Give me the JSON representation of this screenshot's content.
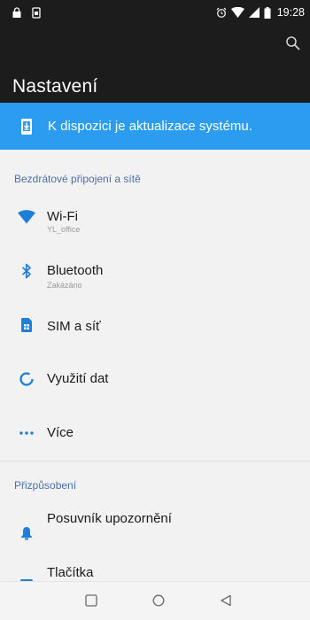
{
  "status_bar": {
    "time": "19:28",
    "left_icons": [
      "lock-icon",
      "sim-card-icon"
    ],
    "right_icons": [
      "alarm-icon",
      "wifi-icon",
      "signal-icon",
      "battery-icon"
    ]
  },
  "app_bar": {
    "title": "Nastavení",
    "action_icon": "search-icon"
  },
  "update_banner": {
    "text": "K dispozici je aktualizace systému.",
    "icon": "system-update-icon",
    "color": "#2b9cf0"
  },
  "sections": [
    {
      "header": "Bezdrátové připojení a sítě",
      "items": [
        {
          "label": "Wi-Fi",
          "subtitle": "YL_office",
          "icon": "wifi-icon"
        },
        {
          "label": "Bluetooth",
          "subtitle": "Zakázáno",
          "icon": "bluetooth-icon"
        },
        {
          "label": "SIM a síť",
          "subtitle": "",
          "icon": "sim-card-icon"
        },
        {
          "label": "Využití dat",
          "subtitle": "",
          "icon": "data-usage-icon"
        },
        {
          "label": "Více",
          "subtitle": "",
          "icon": "more-icon"
        }
      ]
    },
    {
      "header": "Přizpůsobení",
      "items": [
        {
          "label": "Posuvník upozornění",
          "subtitle": "",
          "icon": "notification-slider-icon"
        },
        {
          "label": "Tlačítka",
          "subtitle": "",
          "icon": "buttons-icon"
        }
      ]
    }
  ],
  "nav_bar": {
    "buttons": [
      "recents-button",
      "home-button",
      "back-button"
    ]
  },
  "colors": {
    "accent": "#2b9cf0",
    "section_header": "#4a6ea8",
    "dark_bar": "#1c1c1c",
    "icon_blue": "#1e7fd8"
  }
}
